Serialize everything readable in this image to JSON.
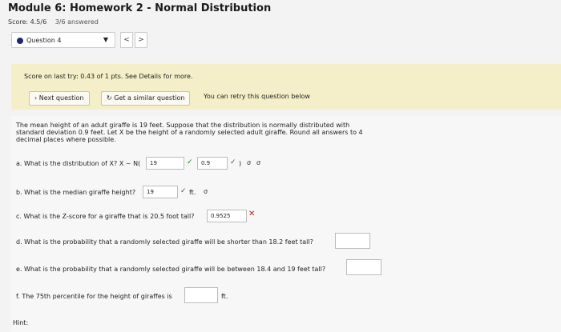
{
  "header": {
    "title": "Module 6: Homework 2 - Normal Distribution",
    "score_label": "Score: 4.5/6",
    "answered": "3/6 answered"
  },
  "question_select": {
    "value": "Question 4"
  },
  "icons": {
    "question_dot": "filled-circle",
    "caret": "▼",
    "prev": "<",
    "next": ">",
    "check": "✓",
    "x": "✕",
    "refresh": "↻",
    "arrow_right": "›",
    "sigma": "σ"
  },
  "banner": {
    "score_msg": "Score on last try: 0.43 of 1 pts. See Details for more.",
    "next_question": "Next question",
    "similar_question": "Get a similar question",
    "retry_msg": "You can retry this question below"
  },
  "problem": {
    "text_line1": "The mean height of an adult giraffe is 19 feet. Suppose that the distribution is normally distributed with",
    "text_line2": "standard deviation 0.9 feet. Let X be the height of a randomly selected adult giraffe. Round all answers to 4",
    "text_line3": "decimal places where possible."
  },
  "parts": {
    "a": {
      "prompt": "a. What is the distribution of X? X ~ N(",
      "val1": "19",
      "val2": "0.9",
      "close": ")"
    },
    "b": {
      "prompt": "b. What is the median giraffe height?",
      "val": "19",
      "unit": "ft."
    },
    "c": {
      "prompt": "c. What is the Z-score for a giraffe that is 20.5 foot tall?",
      "val": "0.9525"
    },
    "d": {
      "prompt": "d. What is the probability that a randomly selected giraffe will be shorter than 18.2 feet tall?",
      "val": ""
    },
    "e": {
      "prompt": "e. What is the probability that a randomly selected giraffe will be between 18.4 and 19 feet tall?",
      "val": ""
    },
    "f": {
      "prompt": "f. The 75th percentile for the height of giraffes is",
      "val": "",
      "unit": "ft."
    }
  },
  "hint": "Hint:",
  "colors": {
    "banner_bg": "#f4efc8",
    "dot": "#1c2a6a",
    "check": "#2a6a2a",
    "wrong": "#b22222"
  }
}
